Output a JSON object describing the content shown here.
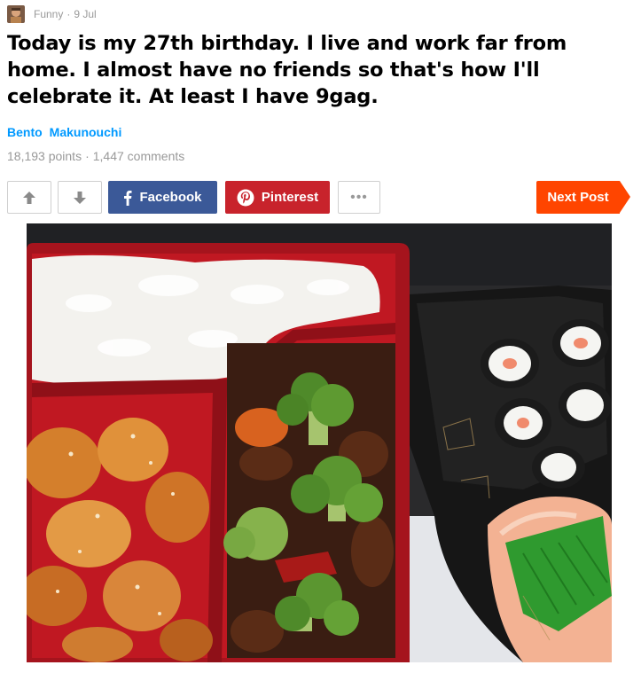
{
  "post": {
    "section": "Funny",
    "separator": "·",
    "date": "9 Jul",
    "title": "Today is my 27th birthday. I live and work far from home. I almost have no friends so that's how I'll celebrate it. At least I have 9gag.",
    "author": {
      "first": "Bento",
      "last": "Makunouchi"
    },
    "points": "18,193 points",
    "comments": "1,447 comments"
  },
  "actions": {
    "upvote_icon": "arrow-up-icon",
    "downvote_icon": "arrow-down-icon",
    "facebook_label": "Facebook",
    "pinterest_label": "Pinterest",
    "more_label": "•••",
    "next_label": "Next Post"
  },
  "colors": {
    "author": "#0099ff",
    "facebook": "#3b5998",
    "pinterest": "#c8232c",
    "next": "#ff4500",
    "muted": "#999999"
  },
  "image": {
    "subject": "bento-box-photo"
  }
}
